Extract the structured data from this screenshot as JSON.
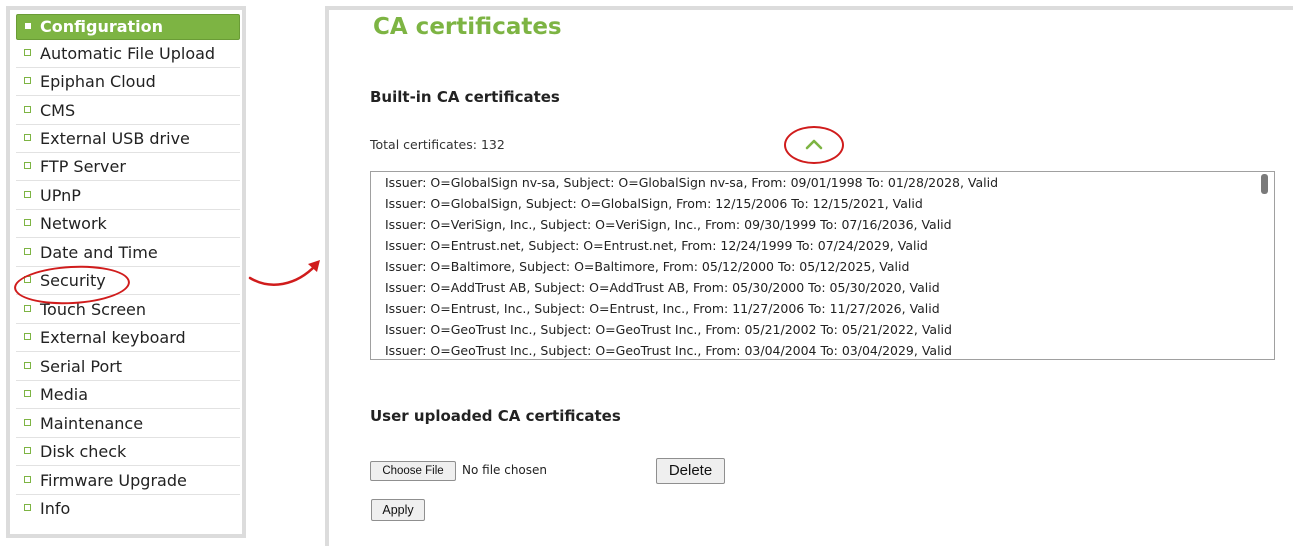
{
  "sidebar": {
    "header": "Configuration",
    "items": [
      {
        "label": "Automatic File Upload"
      },
      {
        "label": "Epiphan Cloud"
      },
      {
        "label": "CMS"
      },
      {
        "label": "External USB drive"
      },
      {
        "label": "FTP Server"
      },
      {
        "label": "UPnP"
      },
      {
        "label": "Network"
      },
      {
        "label": "Date and Time"
      },
      {
        "label": "Security"
      },
      {
        "label": "Touch Screen"
      },
      {
        "label": "External keyboard"
      },
      {
        "label": "Serial Port"
      },
      {
        "label": "Media"
      },
      {
        "label": "Maintenance"
      },
      {
        "label": "Disk check"
      },
      {
        "label": "Firmware Upgrade"
      },
      {
        "label": "Info"
      }
    ]
  },
  "main": {
    "title": "CA certificates",
    "builtin": {
      "heading": "Built-in CA certificates",
      "total_label": "Total certificates: 132",
      "certificates": [
        "Issuer: O=GlobalSign nv-sa, Subject: O=GlobalSign nv-sa, From: 09/01/1998 To: 01/28/2028, Valid",
        "Issuer: O=GlobalSign, Subject: O=GlobalSign, From: 12/15/2006 To: 12/15/2021, Valid",
        "Issuer: O=VeriSign, Inc., Subject: O=VeriSign, Inc., From: 09/30/1999 To: 07/16/2036, Valid",
        "Issuer: O=Entrust.net, Subject: O=Entrust.net, From: 12/24/1999 To: 07/24/2029, Valid",
        "Issuer: O=Baltimore, Subject: O=Baltimore, From: 05/12/2000 To: 05/12/2025, Valid",
        "Issuer: O=AddTrust AB, Subject: O=AddTrust AB, From: 05/30/2000 To: 05/30/2020, Valid",
        "Issuer: O=Entrust, Inc., Subject: O=Entrust, Inc., From: 11/27/2006 To: 11/27/2026, Valid",
        "Issuer: O=GeoTrust Inc., Subject: O=GeoTrust Inc., From: 05/21/2002 To: 05/21/2022, Valid",
        "Issuer: O=GeoTrust Inc., Subject: O=GeoTrust Inc., From: 03/04/2004 To: 03/04/2029, Valid"
      ]
    },
    "uploaded": {
      "heading": "User uploaded CA certificates",
      "choose_file_label": "Choose File",
      "no_file_text": "No file chosen",
      "delete_label": "Delete",
      "apply_label": "Apply"
    }
  },
  "colors": {
    "accent_green": "#7db443",
    "annotation_red": "#d01c1c",
    "panel_border": "#dcdcdc"
  },
  "icons": {
    "collapse": "chevron-up-icon",
    "callout_arrow": "curved-arrow-icon"
  }
}
